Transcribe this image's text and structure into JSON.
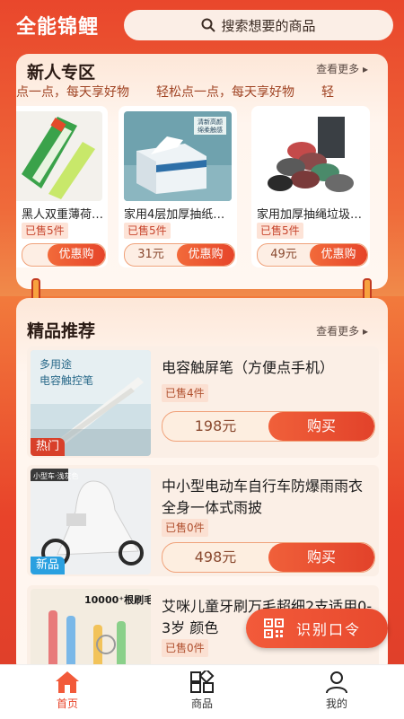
{
  "header": {
    "app_title": "全能锦鲤",
    "search_placeholder": "搜索想要的商品"
  },
  "newcomer": {
    "title": "新人专区",
    "more": "查看更多",
    "marquee": [
      "点一点，每天享好物",
      "轻松点一点，每天享好物",
      "轻"
    ],
    "items": [
      {
        "name": "黑人双重薄荷…",
        "sold": "已售5件",
        "price": "",
        "button": "优惠购"
      },
      {
        "name": "家用4层加厚抽纸…",
        "sold": "已售5件",
        "price": "31元",
        "button": "优惠购"
      },
      {
        "name": "家用加厚抽绳垃圾…",
        "sold": "已售5件",
        "price": "49元",
        "button": "优惠购"
      }
    ]
  },
  "featured": {
    "title": "精品推荐",
    "more": "查看更多",
    "products": [
      {
        "name": "电容触屏笔（方便点手机）",
        "sold": "已售4件",
        "price": "198元",
        "button": "购买",
        "tag": "热门",
        "tag_color": "#d8402a",
        "img_text1": "多用途",
        "img_text2": "电容触控笔"
      },
      {
        "name": "中小型电动车自行车防爆雨雨衣全身一体式雨披",
        "sold": "已售0件",
        "price": "498元",
        "button": "购买",
        "tag": "新品",
        "tag_color": "#2aa0e0",
        "img_text1": "小型车·浅灰色"
      },
      {
        "name": "艾咪儿童牙刷万毛超细2支适用0-3岁 颜色",
        "sold": "已售0件",
        "price": "",
        "button": "",
        "tag": "",
        "img_text1": "10000⁺根刷毛"
      }
    ]
  },
  "float_button": {
    "label": "识别口令"
  },
  "tabbar": {
    "items": [
      {
        "label": "首页",
        "active": true
      },
      {
        "label": "商品",
        "active": false
      },
      {
        "label": "我的",
        "active": false
      }
    ]
  },
  "colors": {
    "primary": "#e8442a",
    "accent": "#f26a3a"
  }
}
